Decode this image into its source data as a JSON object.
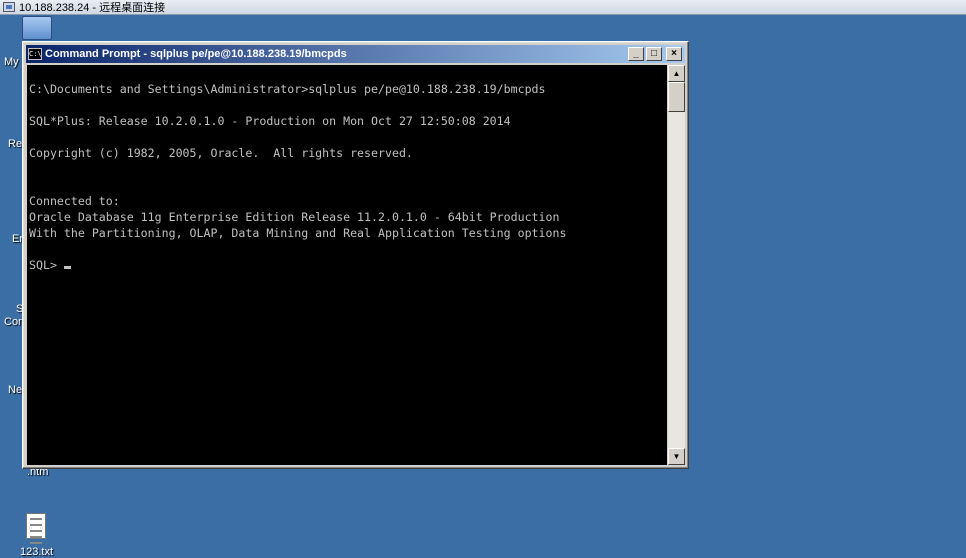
{
  "rdp": {
    "title": "10.188.238.24 - 远程桌面连接"
  },
  "desktop": {
    "labels": [
      "My",
      "Re",
      "Er",
      "S",
      "Con",
      "Ne",
      ".ntm",
      "123.txt"
    ]
  },
  "window": {
    "title": "Command Prompt - sqlplus pe/pe@10.188.238.19/bmcpds",
    "icon_text": "C:\\",
    "minimize": "_",
    "maximize": "□",
    "close": "×"
  },
  "console": {
    "lines": [
      "C:\\Documents and Settings\\Administrator>sqlplus pe/pe@10.188.238.19/bmcpds",
      "SQL*Plus: Release 10.2.0.1.0 - Production on Mon Oct 27 12:50:08 2014",
      "Copyright (c) 1982, 2005, Oracle.  All rights reserved.",
      "Connected to:",
      "Oracle Database 11g Enterprise Edition Release 11.2.0.1.0 - 64bit Production",
      "With the Partitioning, OLAP, Data Mining and Real Application Testing options",
      "SQL>"
    ]
  },
  "scrollbar": {
    "up": "▲",
    "down": "▼"
  }
}
